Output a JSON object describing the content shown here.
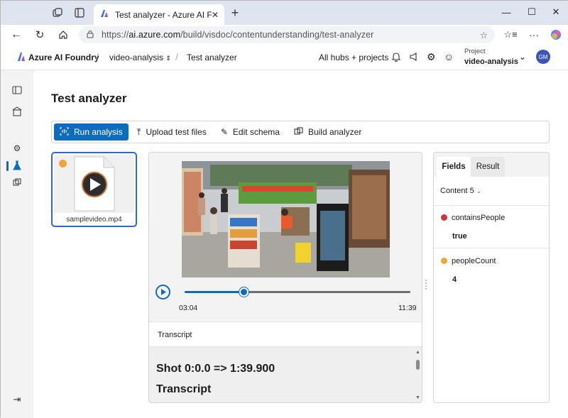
{
  "browser": {
    "tab_title": "Test analyzer - Azure AI Foundry",
    "url_prefix": "https://",
    "url_host": "ai.azure.com",
    "url_path": "/build/visdoc/contentunderstanding/test-analyzer"
  },
  "header": {
    "brand": "Azure AI Foundry",
    "project_crumb": "video-analysis",
    "page_crumb": "Test analyzer",
    "hubs_link": "All hubs + projects",
    "project_label": "Project",
    "project_name": "video-analysis",
    "avatar_initials": "GM"
  },
  "page": {
    "title": "Test analyzer"
  },
  "toolbar": {
    "run": "Run analysis",
    "upload": "Upload test files",
    "edit": "Edit schema",
    "build": "Build analyzer"
  },
  "file": {
    "name": "samplevideo.mp4",
    "status_color": "#f1a537"
  },
  "player": {
    "current_time": "03:04",
    "duration": "11:39",
    "progress_fraction": 0.263
  },
  "transcript": {
    "label": "Transcript",
    "shot_heading": "Shot 0:0.0 => 1:39.900",
    "sub_heading": "Transcript"
  },
  "results": {
    "tabs": [
      "Fields",
      "Result"
    ],
    "active_tab": "Fields",
    "content_selector": "Content 5",
    "fields": [
      {
        "name": "containsPeople",
        "value": "true",
        "color": "#d13438"
      },
      {
        "name": "peopleCount",
        "value": "4",
        "color": "#f1a537"
      }
    ]
  },
  "colors": {
    "accent": "#0f6cbd"
  },
  "icons": [
    "collections-icon",
    "tab-actions-icon",
    "new-tab-icon",
    "back-icon",
    "refresh-icon",
    "home-icon",
    "site-info-icon",
    "favorite-icon",
    "favorites-icon",
    "more-icon",
    "copilot-icon",
    "bell-icon",
    "feedback-icon",
    "settings-icon",
    "smiley-icon",
    "chevron-down-icon",
    "play-icon"
  ]
}
